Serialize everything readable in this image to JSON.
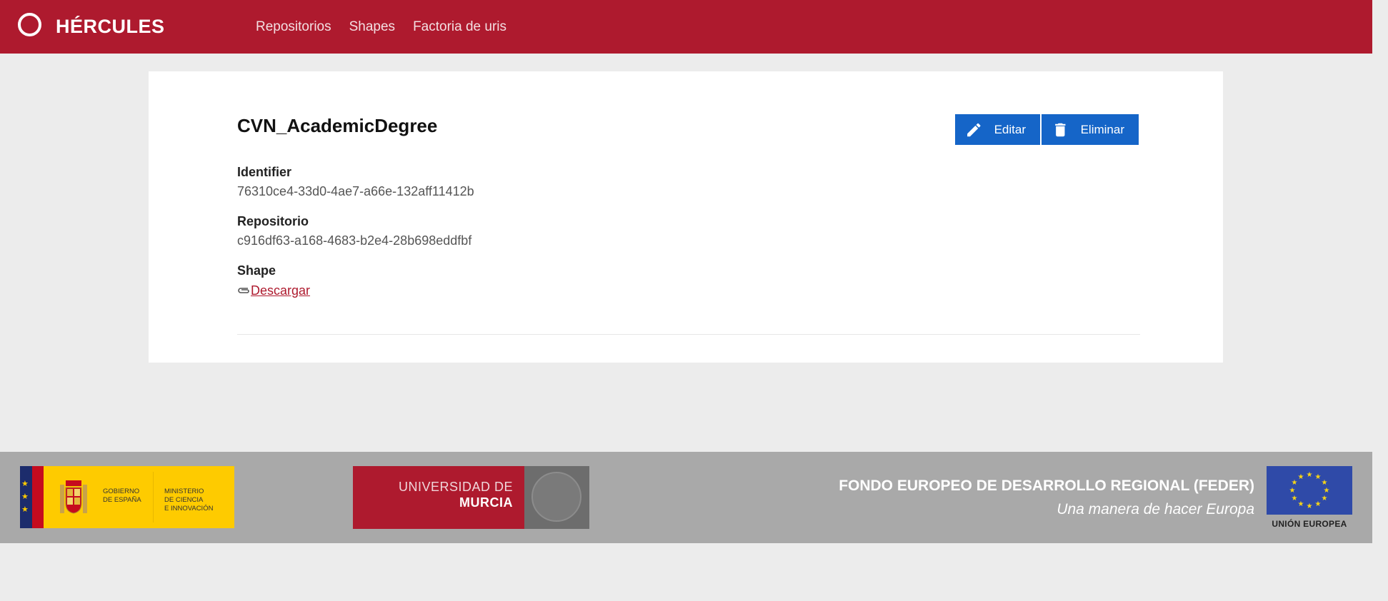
{
  "header": {
    "logo_text": "HÉRCULES",
    "nav": [
      "Repositorios",
      "Shapes",
      "Factoria de uris"
    ]
  },
  "detail": {
    "title": "CVN_AcademicDegree",
    "edit_label": "Editar",
    "delete_label": "Eliminar",
    "fields": [
      {
        "label": "Identifier",
        "value": "76310ce4-33d0-4ae7-a66e-132aff11412b"
      },
      {
        "label": "Repositorio",
        "value": "c916df63-a168-4683-b2e4-28b698eddfbf"
      },
      {
        "label": "Shape",
        "link": "Descargar"
      }
    ]
  },
  "footer": {
    "gov_text": [
      "GOBIERNO",
      "DE ESPAÑA"
    ],
    "ministry_text": [
      "MINISTERIO",
      "DE CIENCIA",
      "E INNOVACIÓN"
    ],
    "university": [
      "UNIVERSIDAD DE",
      "MURCIA"
    ],
    "feder_title": "FONDO EUROPEO DE DESARROLLO REGIONAL (FEDER)",
    "feder_subtitle": "Una manera de hacer Europa",
    "eu_caption": "UNIÓN EUROPEA"
  },
  "colors": {
    "brand": "#ae1a2e",
    "button": "#1565c8",
    "footer": "#a9a9a9",
    "background": "#ececec"
  },
  "icons": {
    "edit": "pencil-icon",
    "delete": "trash-icon",
    "download": "paperclip-icon"
  }
}
